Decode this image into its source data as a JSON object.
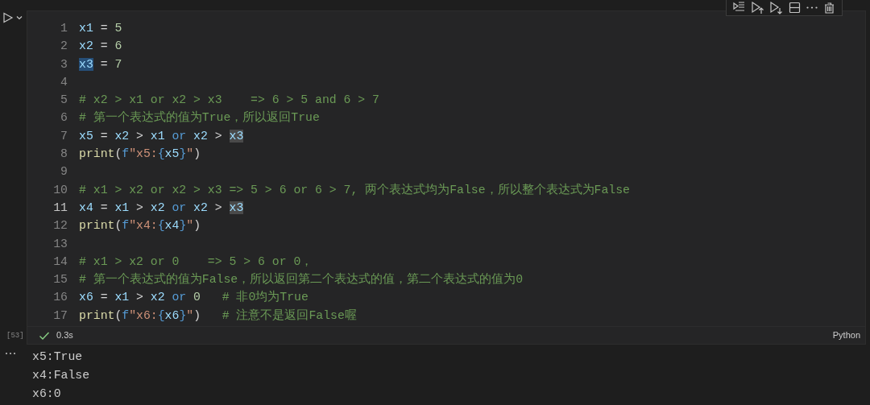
{
  "cell": {
    "execution_count": "[53]",
    "lines": [
      {
        "number": "1",
        "current": false,
        "tokens": [
          {
            "kind": "var",
            "text": "x1"
          },
          {
            "kind": "plain",
            "text": " = "
          },
          {
            "kind": "num",
            "text": "5"
          }
        ]
      },
      {
        "number": "2",
        "current": false,
        "tokens": [
          {
            "kind": "var",
            "text": "x2"
          },
          {
            "kind": "plain",
            "text": " = "
          },
          {
            "kind": "num",
            "text": "6"
          }
        ]
      },
      {
        "number": "3",
        "current": false,
        "tokens": [
          {
            "kind": "var",
            "text": "x3",
            "selected": true
          },
          {
            "kind": "plain",
            "text": " = "
          },
          {
            "kind": "num",
            "text": "7"
          }
        ]
      },
      {
        "number": "4",
        "current": false
      },
      {
        "number": "5",
        "current": false,
        "tokens": [
          {
            "kind": "comment",
            "text": "# x2 > x1 or x2 > x3    => 6 > 5 and 6 > 7"
          }
        ]
      },
      {
        "number": "6",
        "current": false,
        "tokens": [
          {
            "kind": "comment",
            "text": "# 第一个表达式的值为True，所以返回True"
          }
        ]
      },
      {
        "number": "7",
        "current": false,
        "tokens": [
          {
            "kind": "var",
            "text": "x5"
          },
          {
            "kind": "plain",
            "text": " = "
          },
          {
            "kind": "var",
            "text": "x2"
          },
          {
            "kind": "plain",
            "text": " > "
          },
          {
            "kind": "var",
            "text": "x1"
          },
          {
            "kind": "kw",
            "text": " or "
          },
          {
            "kind": "var",
            "text": "x2"
          },
          {
            "kind": "plain",
            "text": " > "
          },
          {
            "kind": "var",
            "text": "x3",
            "highlighted": true
          }
        ]
      },
      {
        "number": "8",
        "current": false,
        "tokens": [
          {
            "kind": "func",
            "text": "print"
          },
          {
            "kind": "plain",
            "text": "("
          },
          {
            "kind": "kw",
            "text": "f"
          },
          {
            "kind": "str",
            "text": "\"x5:"
          },
          {
            "kind": "kw",
            "text": "{"
          },
          {
            "kind": "var",
            "text": "x5"
          },
          {
            "kind": "kw",
            "text": "}"
          },
          {
            "kind": "str",
            "text": "\""
          },
          {
            "kind": "plain",
            "text": ")"
          }
        ]
      },
      {
        "number": "9",
        "current": false
      },
      {
        "number": "10",
        "current": false,
        "tokens": [
          {
            "kind": "comment",
            "text": "# x1 > x2 or x2 > x3 => 5 > 6 or 6 > 7, 两个表达式均为False，所以整个表达式为False"
          }
        ]
      },
      {
        "number": "11",
        "current": true,
        "tokens": [
          {
            "kind": "var",
            "text": "x4"
          },
          {
            "kind": "plain",
            "text": " = "
          },
          {
            "kind": "var",
            "text": "x1"
          },
          {
            "kind": "plain",
            "text": " > "
          },
          {
            "kind": "var",
            "text": "x2"
          },
          {
            "kind": "kw",
            "text": " or "
          },
          {
            "kind": "var",
            "text": "x2"
          },
          {
            "kind": "plain",
            "text": " > "
          },
          {
            "kind": "var",
            "text": "x3",
            "highlighted": true
          }
        ]
      },
      {
        "number": "12",
        "current": false,
        "tokens": [
          {
            "kind": "func",
            "text": "print"
          },
          {
            "kind": "plain",
            "text": "("
          },
          {
            "kind": "kw",
            "text": "f"
          },
          {
            "kind": "str",
            "text": "\"x4:"
          },
          {
            "kind": "kw",
            "text": "{"
          },
          {
            "kind": "var",
            "text": "x4"
          },
          {
            "kind": "kw",
            "text": "}"
          },
          {
            "kind": "str",
            "text": "\""
          },
          {
            "kind": "plain",
            "text": ")"
          }
        ]
      },
      {
        "number": "13",
        "current": false
      },
      {
        "number": "14",
        "current": false,
        "tokens": [
          {
            "kind": "comment",
            "text": "# x1 > x2 or 0    => 5 > 6 or 0，"
          }
        ]
      },
      {
        "number": "15",
        "current": false,
        "tokens": [
          {
            "kind": "comment",
            "text": "# 第一个表达式的值为False，所以返回第二个表达式的值，第二个表达式的值为0"
          }
        ]
      },
      {
        "number": "16",
        "current": false,
        "tokens": [
          {
            "kind": "var",
            "text": "x6"
          },
          {
            "kind": "plain",
            "text": " = "
          },
          {
            "kind": "var",
            "text": "x1"
          },
          {
            "kind": "plain",
            "text": " > "
          },
          {
            "kind": "var",
            "text": "x2"
          },
          {
            "kind": "kw",
            "text": " or "
          },
          {
            "kind": "num",
            "text": "0"
          },
          {
            "kind": "comment",
            "text": "   # 非0均为True"
          }
        ]
      },
      {
        "number": "17",
        "current": false,
        "tokens": [
          {
            "kind": "func",
            "text": "print"
          },
          {
            "kind": "plain",
            "text": "("
          },
          {
            "kind": "kw",
            "text": "f"
          },
          {
            "kind": "str",
            "text": "\"x6:"
          },
          {
            "kind": "kw",
            "text": "{"
          },
          {
            "kind": "var",
            "text": "x6"
          },
          {
            "kind": "kw",
            "text": "}"
          },
          {
            "kind": "str",
            "text": "\""
          },
          {
            "kind": "plain",
            "text": ")"
          },
          {
            "kind": "comment",
            "text": "   # 注意不是返回False喔"
          }
        ]
      }
    ],
    "status": {
      "succeeded": true,
      "duration": "0.3s",
      "language": "Python"
    }
  },
  "output": {
    "lines": [
      "x5:True",
      "x4:False",
      "x6:0"
    ]
  }
}
